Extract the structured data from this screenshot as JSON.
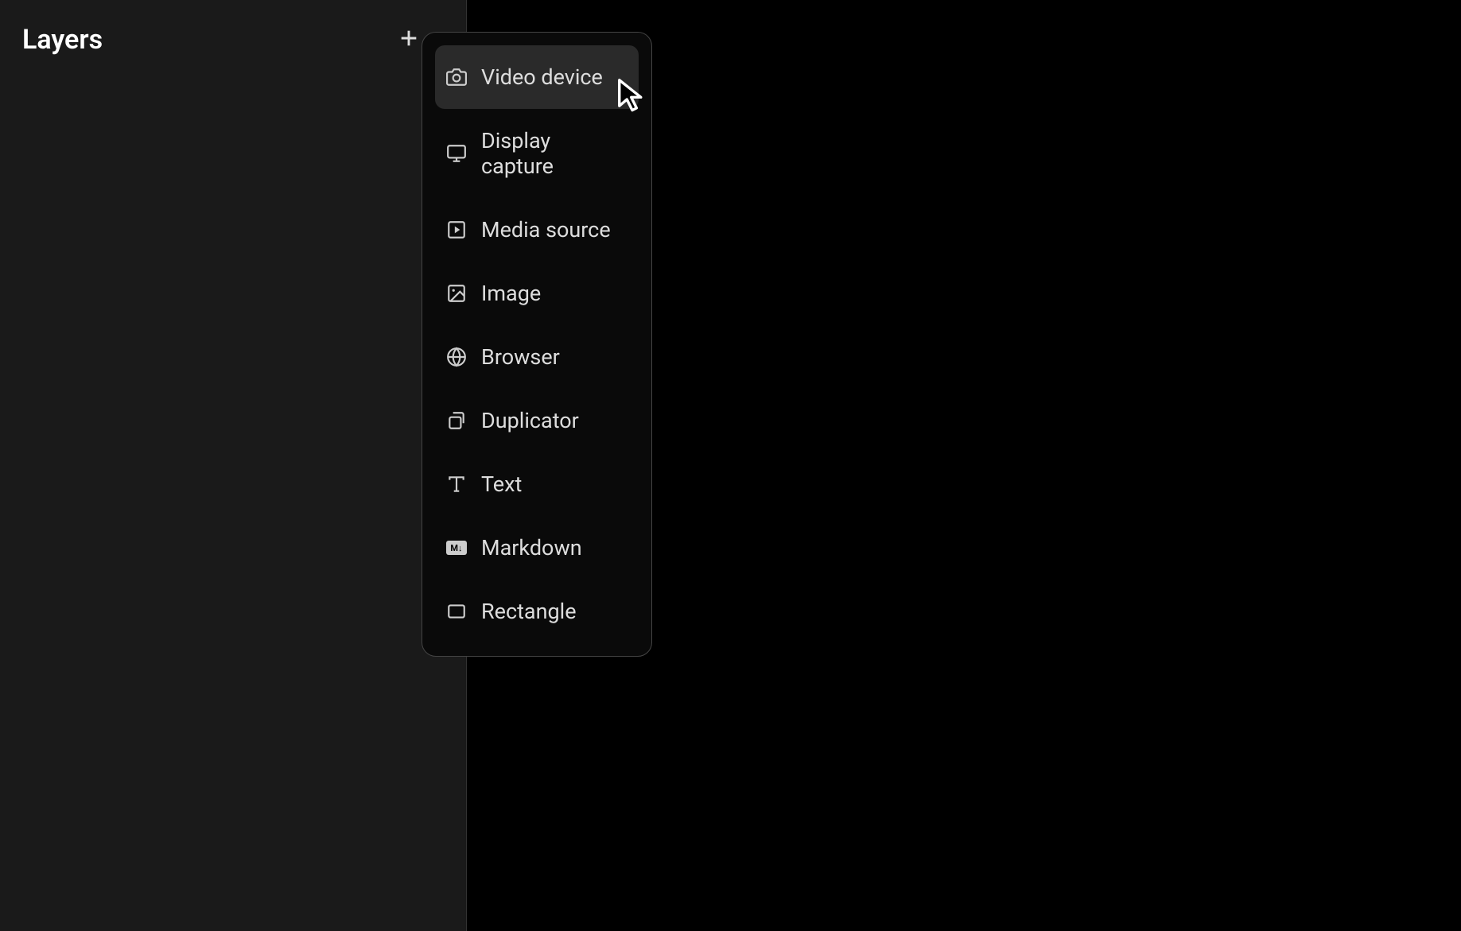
{
  "sidebar": {
    "title": "Layers"
  },
  "menu": {
    "items": [
      {
        "label": "Video device",
        "icon": "camera",
        "highlighted": true
      },
      {
        "label": "Display capture",
        "icon": "monitor",
        "highlighted": false
      },
      {
        "label": "Media source",
        "icon": "play-square",
        "highlighted": false
      },
      {
        "label": "Image",
        "icon": "image",
        "highlighted": false
      },
      {
        "label": "Browser",
        "icon": "globe",
        "highlighted": false
      },
      {
        "label": "Duplicator",
        "icon": "duplicate",
        "highlighted": false
      },
      {
        "label": "Text",
        "icon": "text",
        "highlighted": false
      },
      {
        "label": "Markdown",
        "icon": "markdown",
        "highlighted": false
      },
      {
        "label": "Rectangle",
        "icon": "rectangle",
        "highlighted": false
      }
    ]
  }
}
